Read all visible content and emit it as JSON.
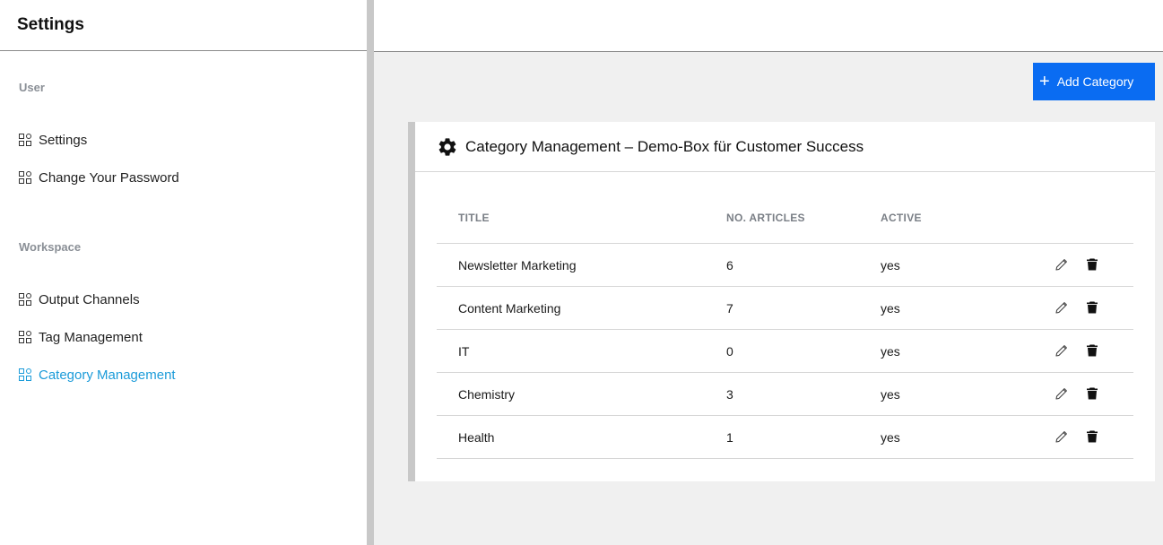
{
  "sidebar": {
    "title": "Settings",
    "sections": [
      {
        "label": "User",
        "items": [
          {
            "label": "Settings"
          },
          {
            "label": "Change Your Password"
          }
        ]
      },
      {
        "label": "Workspace",
        "items": [
          {
            "label": "Output Channels"
          },
          {
            "label": "Tag Management"
          },
          {
            "label": "Category Management",
            "active": true
          }
        ]
      }
    ]
  },
  "toolbar": {
    "add_label": "Add Category"
  },
  "card": {
    "title": "Category Management – Demo-Box für Customer Success"
  },
  "table": {
    "columns": [
      "TITLE",
      "NO. ARTICLES",
      "ACTIVE"
    ],
    "rows": [
      {
        "title": "Newsletter Marketing",
        "articles": "6",
        "active": "yes"
      },
      {
        "title": "Content Marketing",
        "articles": "7",
        "active": "yes"
      },
      {
        "title": "IT",
        "articles": "0",
        "active": "yes"
      },
      {
        "title": "Chemistry",
        "articles": "3",
        "active": "yes"
      },
      {
        "title": "Health",
        "articles": "1",
        "active": "yes"
      }
    ]
  },
  "colors": {
    "accent": "#0a6cf2",
    "active_nav": "#1b9bd9"
  }
}
